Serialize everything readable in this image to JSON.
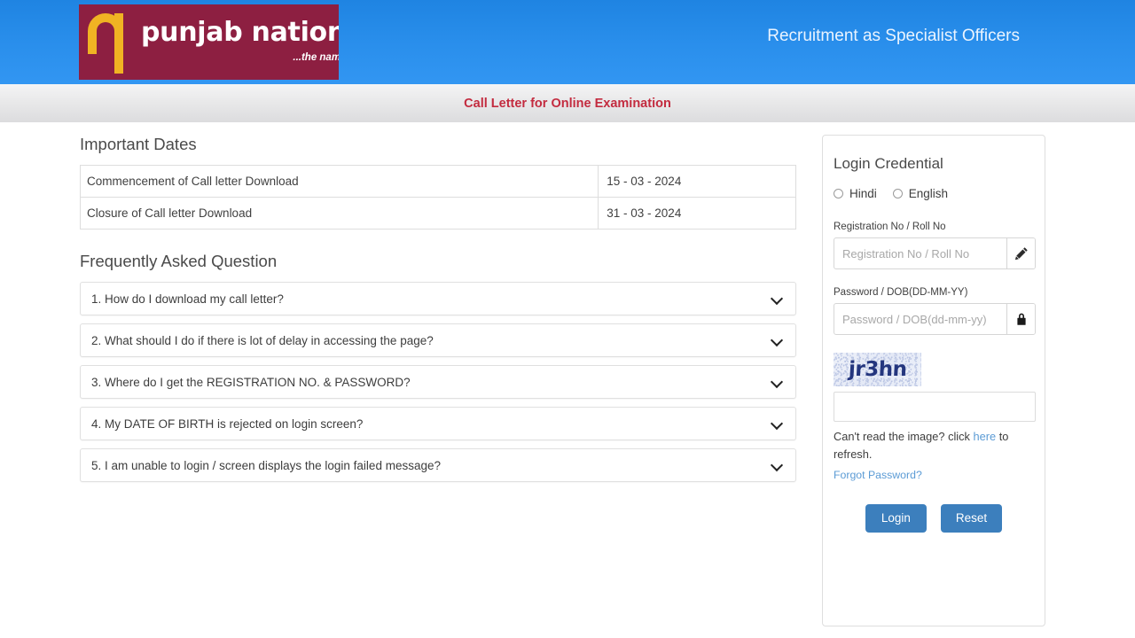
{
  "header": {
    "logo_name": "punjab national bank",
    "logo_tagline": "...the name you can BANK upon !",
    "title": "Recruitment as Specialist Officers"
  },
  "subbanner": {
    "text": "Call Letter for Online Examination"
  },
  "important_dates": {
    "heading": "Important Dates",
    "rows": [
      {
        "label": "Commencement of Call letter Download",
        "value": "15 - 03 - 2024"
      },
      {
        "label": "Closure of Call letter Download",
        "value": "31 - 03 - 2024"
      }
    ]
  },
  "faq": {
    "heading": "Frequently Asked Question",
    "items": [
      {
        "question": "1. How do I download my call letter?"
      },
      {
        "question": "2. What should I do if there is lot of delay in accessing the page?"
      },
      {
        "question": "3. Where do I get the REGISTRATION NO. & PASSWORD?"
      },
      {
        "question": "4. My DATE OF BIRTH is rejected on login screen?"
      },
      {
        "question": "5. I am unable to login / screen displays the login failed message?"
      }
    ]
  },
  "login": {
    "heading": "Login Credential",
    "language_options": [
      {
        "label": "Hindi",
        "selected": false
      },
      {
        "label": "English",
        "selected": false
      }
    ],
    "registration": {
      "label": "Registration No / Roll No",
      "placeholder": "Registration No / Roll No",
      "value": "",
      "icon": "pencil-icon"
    },
    "password": {
      "label": "Password / DOB(DD-MM-YY)",
      "placeholder": "Password / DOB(dd-mm-yy)",
      "value": "",
      "icon": "lock-icon"
    },
    "captcha": {
      "text": "jr3hn",
      "input_value": "",
      "input_placeholder": ""
    },
    "refresh_note_pre": "Can't read the image? click ",
    "refresh_link": "here",
    "refresh_note_post": " to refresh.",
    "forgot_password": "Forgot Password?",
    "buttons": {
      "login": "Login",
      "reset": "Reset"
    }
  },
  "colors": {
    "header_blue": "#2a8fec",
    "logo_maroon": "#8d1f41",
    "logo_gold": "#f0b323",
    "banner_text_red": "#c32b3f",
    "button_blue": "#3c7fbd",
    "link_blue": "#5b9bd5",
    "captcha_navy": "#24367e"
  }
}
